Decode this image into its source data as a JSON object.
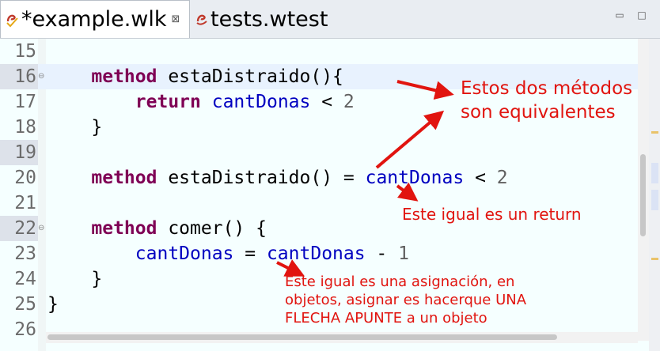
{
  "tabs": [
    {
      "label": "*example.wlk",
      "close_glyph": "⊠",
      "icon": "wollok-file-icon",
      "active": true
    },
    {
      "label": "tests.wtest",
      "icon": "wollok-test-icon",
      "active": false
    }
  ],
  "window_controls": {
    "minimize": "▭",
    "maximize": "□"
  },
  "editor": {
    "lines": [
      {
        "num": "15",
        "marker": ""
      },
      {
        "num": "16",
        "marker": "⊖"
      },
      {
        "num": "17",
        "marker": ""
      },
      {
        "num": "18",
        "marker": ""
      },
      {
        "num": "19",
        "marker": ""
      },
      {
        "num": "20",
        "marker": ""
      },
      {
        "num": "21",
        "marker": ""
      },
      {
        "num": "22",
        "marker": "⊖"
      },
      {
        "num": "23",
        "marker": ""
      },
      {
        "num": "24",
        "marker": ""
      },
      {
        "num": "25",
        "marker": ""
      },
      {
        "num": "26",
        "marker": ""
      }
    ],
    "tokens": {
      "method": "method",
      "return": "return",
      "m1_name": " estaDistraido(){",
      "m1_body_var": "cantDonas",
      "m1_body_op": " < ",
      "m1_body_num": "2",
      "close_brace": "}",
      "m2_name": " estaDistraido() = ",
      "m2_var": "cantDonas",
      "m2_op": " < ",
      "m2_num": "2",
      "m3_name": " comer() {",
      "m3_var_a": "cantDonas",
      "m3_eq": " = ",
      "m3_var_b": "cantDonas",
      "m3_op": " - ",
      "m3_num": "1",
      "obj_close": "}"
    }
  },
  "annotations": {
    "note1_line1": "Estos dos métodos",
    "note1_line2": "son equivalentes",
    "note2": "Este igual es un return",
    "note3_line1": "Este igual es una asignación, en",
    "note3_line2": "objetos, asignar es hacerque UNA",
    "note3_line3": "FLECHA APUNTE a un objeto"
  },
  "colors": {
    "keyword": "#7f0055",
    "identifier": "#0000c0",
    "annotation": "#e1140f",
    "editor_bg": "#f5ffff",
    "current_line": "#e8f2fe"
  }
}
